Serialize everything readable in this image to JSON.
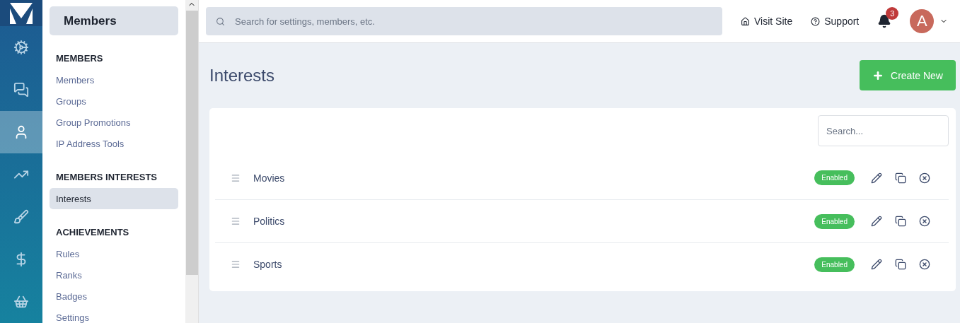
{
  "rail": [
    {
      "kind": "gears",
      "selected": false
    },
    {
      "kind": "chat",
      "selected": false
    },
    {
      "kind": "user",
      "selected": true
    },
    {
      "kind": "chart",
      "selected": false
    },
    {
      "kind": "brush",
      "selected": false
    },
    {
      "kind": "dollar",
      "selected": false
    },
    {
      "kind": "basket",
      "selected": false
    }
  ],
  "sidebar": {
    "title": "Members",
    "sections": [
      {
        "heading": "MEMBERS",
        "items": [
          {
            "label": "Members",
            "selected": false
          },
          {
            "label": "Groups",
            "selected": false
          },
          {
            "label": "Group Promotions",
            "selected": false
          },
          {
            "label": "IP Address Tools",
            "selected": false
          }
        ]
      },
      {
        "heading": "MEMBERS INTERESTS",
        "items": [
          {
            "label": "Interests",
            "selected": true
          }
        ]
      },
      {
        "heading": "ACHIEVEMENTS",
        "items": [
          {
            "label": "Rules",
            "selected": false
          },
          {
            "label": "Ranks",
            "selected": false
          },
          {
            "label": "Badges",
            "selected": false
          },
          {
            "label": "Settings",
            "selected": false
          }
        ]
      }
    ]
  },
  "topbar": {
    "search": {
      "placeholder": "Search for settings, members, etc."
    },
    "visit_site": "Visit Site",
    "support": "Support",
    "notifications": "3",
    "avatar": "A"
  },
  "page": {
    "title": "Interests",
    "create_button": "Create New",
    "search": {
      "placeholder": "Search..."
    },
    "rows": [
      {
        "name": "Movies",
        "status": "Enabled",
        "enabled": true
      },
      {
        "name": "Politics",
        "status": "Enabled",
        "enabled": true
      },
      {
        "name": "Sports",
        "status": "Enabled",
        "enabled": true
      }
    ]
  }
}
